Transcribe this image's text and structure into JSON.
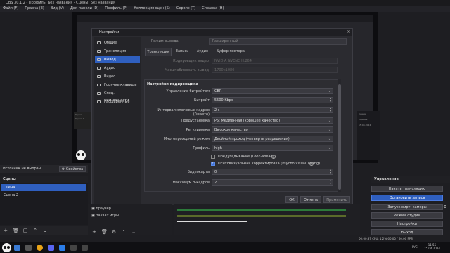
{
  "window": {
    "title": "OBS 30.1.2 - Профиль: Без названия - Сцены: Без названия"
  },
  "menu": [
    "Файл (F)",
    "Правка (E)",
    "Вид (V)",
    "Док-панели (D)",
    "Профиль (P)",
    "Коллекция сцен (S)",
    "Сервис (T)",
    "Справка (H)"
  ],
  "preview": {
    "list": [
      "Сцена",
      "Сцена 2"
    ],
    "side_labels": [
      "Сцена",
      "Сцена 2"
    ],
    "side_time": "15:04.2024"
  },
  "dialog": {
    "title": "Настройки",
    "sidebar": [
      "Общие",
      "Трансляция",
      "Вывод",
      "Аудио",
      "Видео",
      "Горячие клавиши",
      "Спец. возможности",
      "Расширенные"
    ],
    "selected_index": 2,
    "output_mode_label": "Режим вывода",
    "output_mode_value": "Расширенный",
    "tabs": [
      "Трансляция",
      "Запись",
      "Аудио",
      "Буфер повтора"
    ],
    "active_tab": 0,
    "disabled_rows": [
      {
        "label": "Кодировщик видео",
        "value": "NVIDIA NVENC H.264"
      },
      {
        "label": "Масштабировать вывод",
        "value": "1700x1080"
      }
    ],
    "encoder_section_title": "Настройки кодировщика",
    "rows": [
      {
        "label": "Управление битрейтом",
        "value": "CBR"
      },
      {
        "label": "Битрейт",
        "value": "5500 Kbps"
      },
      {
        "label": "Интервал ключевых кадров (0=авто)",
        "value": "2 s"
      },
      {
        "label": "Предустановка",
        "value": "P5: Медленная (хорошее качество)"
      },
      {
        "label": "Регулировка",
        "value": "Высокое качество"
      },
      {
        "label": "Многопроходный режим",
        "value": "Двойной проход (четверть разрешения)"
      },
      {
        "label": "Профиль",
        "value": "high"
      }
    ],
    "checkboxes": [
      {
        "label": "Предугадывание (Look-ahead)",
        "checked": false
      },
      {
        "label": "Психовизуальная корректировка (Psycho Visual Tuning)",
        "checked": true
      }
    ],
    "extra_rows": [
      {
        "label": "Видеокарта",
        "value": "0"
      },
      {
        "label": "Максимум B-кадров",
        "value": "2"
      }
    ],
    "buttons": {
      "ok": "ОК",
      "cancel": "Отмена",
      "apply": "Применить"
    }
  },
  "source_bar": {
    "text": "Источник не выбран",
    "props": "Свойства"
  },
  "scenes": {
    "title": "Сцены",
    "items": [
      "Сцена",
      "Сцена 2"
    ],
    "selected": 0
  },
  "sources": [
    "Браузер",
    "Захват игры"
  ],
  "controls": {
    "title": "Управление",
    "buttons": [
      "Начать трансляцию",
      "Остановить запись",
      "Запуск вирт. камеры",
      "Режим студии",
      "Настройки",
      "Выход"
    ],
    "active": 1
  },
  "status": {
    "text": "00:00:37   CPU: 1.2%   60.00 / 60.00 FPS"
  },
  "taskbar": {
    "lang": "РУС",
    "time": "11:55",
    "date": "15.04.2024"
  },
  "colors": {
    "accent": "#2f5fbf",
    "dialog_bg": "#2b2b30",
    "panel_bg": "#1e1e22"
  }
}
